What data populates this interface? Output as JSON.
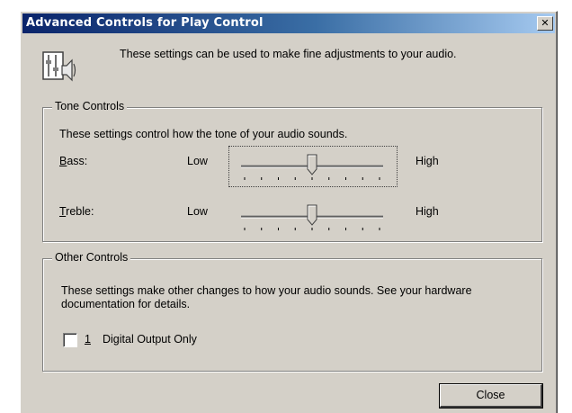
{
  "window": {
    "title": "Advanced Controls for Play Control",
    "close_glyph": "✕"
  },
  "header": {
    "icon": "speaker-settings-icon",
    "text": "These settings can be used to make fine adjustments to your audio."
  },
  "tone": {
    "group_label": "Tone Controls",
    "description": "These settings control how the tone of your audio sounds.",
    "bass": {
      "label_mnemonic": "B",
      "label_rest": "ass:",
      "low": "Low",
      "high": "High",
      "level": 0.5
    },
    "treble": {
      "label_mnemonic": "T",
      "label_rest": "reble:",
      "low": "Low",
      "high": "High",
      "level": 0.5
    }
  },
  "other": {
    "group_label": "Other Controls",
    "description": "These settings make other changes to how your audio sounds.  See your hardware documentation for details.",
    "checkbox": {
      "number": "1",
      "label": "Digital Output Only",
      "checked": false
    }
  },
  "buttons": {
    "close": "Close"
  }
}
